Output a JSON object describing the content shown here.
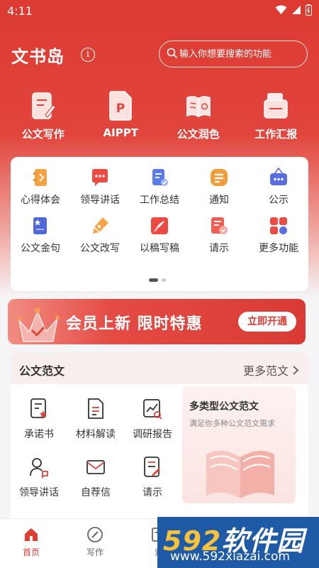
{
  "status_bar": {
    "time": "4:11"
  },
  "header": {
    "title": "文书岛",
    "info": "i"
  },
  "search": {
    "placeholder": "输入你想要搜索的功能"
  },
  "quick_actions": [
    {
      "label": "公文写作",
      "icon": "document-pen-icon"
    },
    {
      "label": "AIPPT",
      "icon": "ppt-file-icon"
    },
    {
      "label": "公文润色",
      "icon": "open-book-icon"
    },
    {
      "label": "工作汇报",
      "icon": "briefcase-folder-icon"
    }
  ],
  "features": [
    {
      "label": "心得体会",
      "icon": "notebook-icon"
    },
    {
      "label": "领导讲话",
      "icon": "speech-bubble-icon"
    },
    {
      "label": "工作总结",
      "icon": "checklist-icon"
    },
    {
      "label": "通知",
      "icon": "notice-icon"
    },
    {
      "label": "公示",
      "icon": "board-icon"
    },
    {
      "label": "公文金句",
      "icon": "star-book-icon"
    },
    {
      "label": "公文改写",
      "icon": "pen-nib-icon"
    },
    {
      "label": "以稿写稿",
      "icon": "quill-icon"
    },
    {
      "label": "请示",
      "icon": "request-doc-icon"
    },
    {
      "label": "更多功能",
      "icon": "grid-icon"
    }
  ],
  "banner": {
    "text": "会员上新 限时特惠",
    "button": "立即开通"
  },
  "templates": {
    "title": "公文范文",
    "more": "更多范文",
    "items": [
      {
        "label": "承诺书",
        "icon": "pledge-doc-icon"
      },
      {
        "label": "材料解读",
        "icon": "material-doc-icon"
      },
      {
        "label": "调研报告",
        "icon": "report-chart-icon"
      },
      {
        "label": "领导讲话",
        "icon": "person-speak-icon"
      },
      {
        "label": "自荐信",
        "icon": "envelope-icon"
      },
      {
        "label": "请示",
        "icon": "memo-pen-icon"
      }
    ],
    "promo": {
      "title": "多类型公文范文",
      "subtitle": "满足你多种公文范文需求"
    }
  },
  "tabbar": [
    {
      "label": "首页",
      "icon": "home-icon",
      "active": true
    },
    {
      "label": "写作",
      "icon": "compass-icon",
      "active": false
    },
    {
      "label": "素",
      "icon": "material-icon",
      "active": false
    }
  ],
  "watermark": {
    "brand_num": "592",
    "brand_text": "软件园",
    "url": "www.592xiazai.com"
  },
  "colors": {
    "primary": "#e03c33",
    "background": "#f5f5f7"
  }
}
